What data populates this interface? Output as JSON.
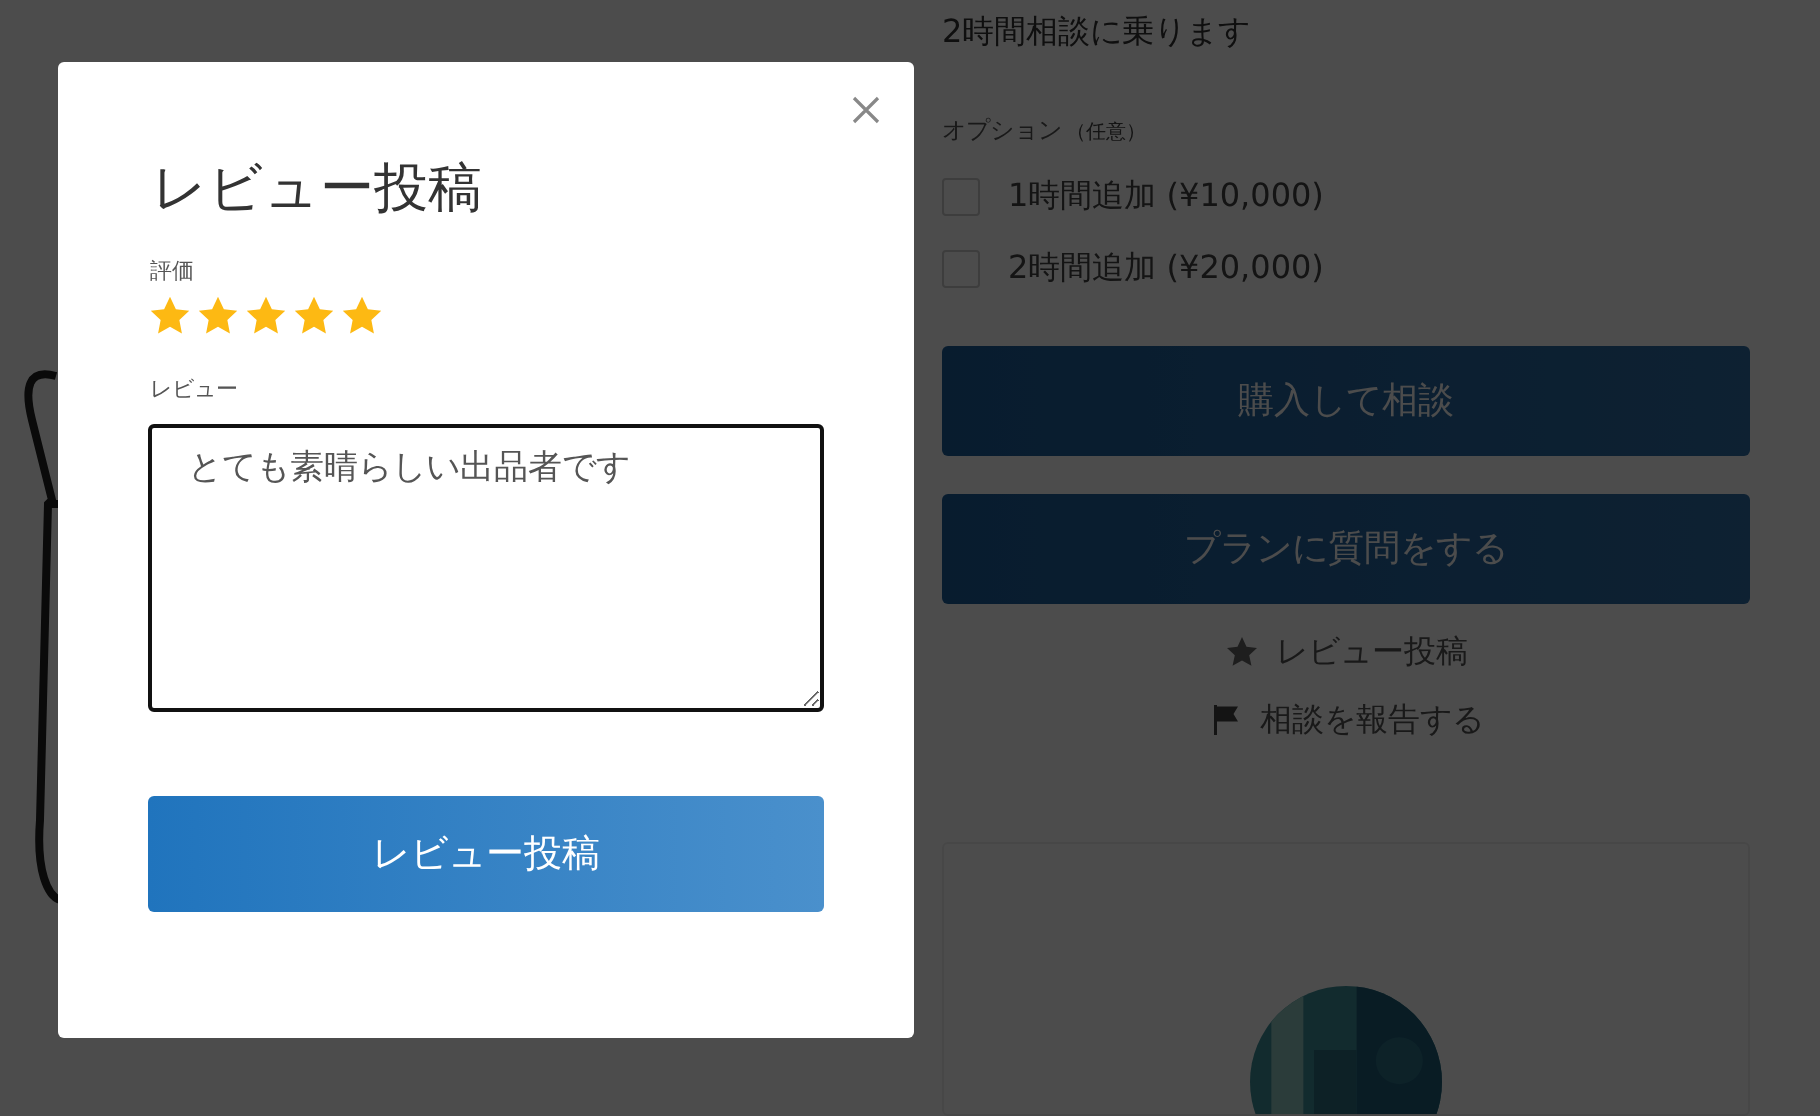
{
  "page": {
    "plan_title": "2時間相談に乗ります",
    "options_label": "オプション",
    "options_note": "（任意）",
    "options": [
      {
        "label": "1時間追加 (¥10,000)",
        "checked": false
      },
      {
        "label": "2時間追加 (¥20,000)",
        "checked": false
      }
    ],
    "buttons": [
      "購入して相談",
      "プランに質問をする"
    ],
    "links": [
      {
        "kind": "star",
        "label": "レビュー投稿"
      },
      {
        "kind": "flag",
        "label": "相談を報告する"
      }
    ]
  },
  "modal": {
    "title": "レビュー投稿",
    "rating_label": "評価",
    "stars": 5,
    "review_label": "レビュー",
    "review_value": "とても素晴らしい出品者です",
    "submit": "レビュー投稿"
  }
}
